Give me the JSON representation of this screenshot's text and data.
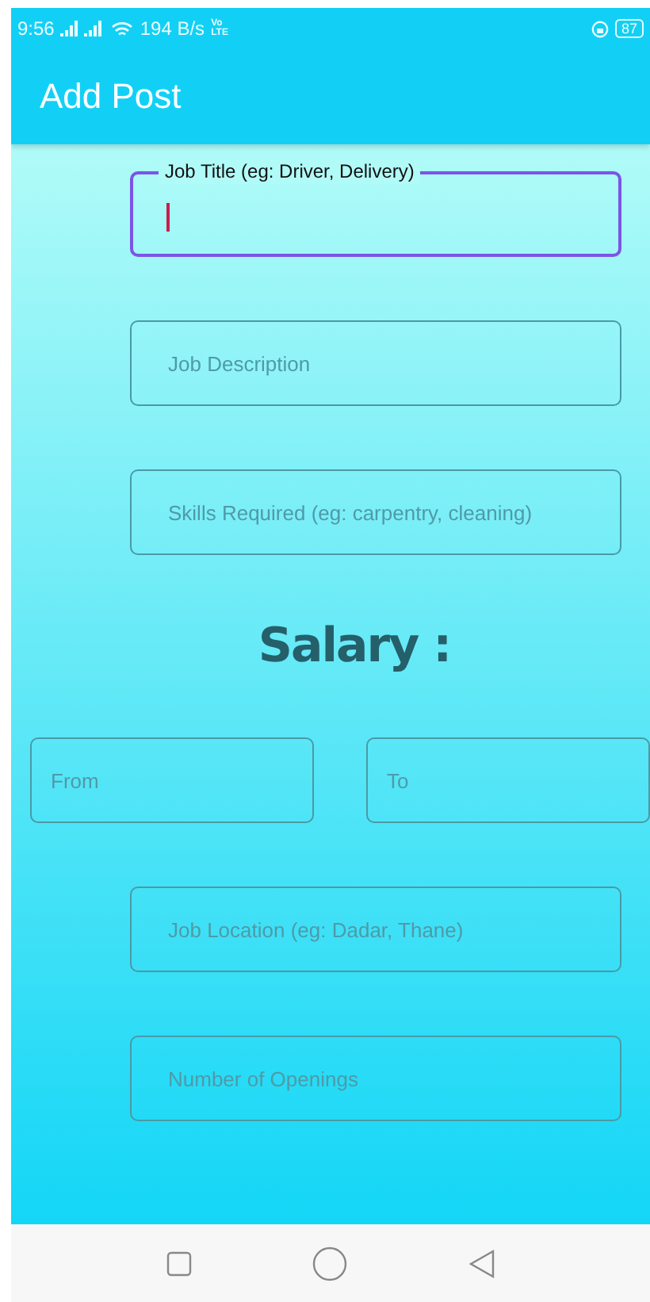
{
  "status_bar": {
    "time": "9:56",
    "speed": "194 B/s",
    "network_top": "Vo",
    "network_bottom": "LTE",
    "battery": "87"
  },
  "app_bar": {
    "title": "Add Post"
  },
  "fields": [
    {
      "kind": "field",
      "label": "Job Title (eg: Driver, Delivery)",
      "focused": true
    },
    {
      "kind": "field",
      "label": "Job Description",
      "focused": false
    },
    {
      "kind": "field",
      "label": "Skills Required (eg: carpentry, cleaning)",
      "focused": false
    },
    {
      "kind": "heading",
      "label": "Salary :"
    },
    {
      "kind": "pair",
      "items": [
        {
          "label": "From",
          "focused": false
        },
        {
          "label": "To",
          "focused": false
        }
      ]
    },
    {
      "kind": "field",
      "label": "Job Location (eg: Dadar, Thane)",
      "focused": false
    },
    {
      "kind": "field",
      "label": "Number of Openings",
      "focused": false
    }
  ]
}
